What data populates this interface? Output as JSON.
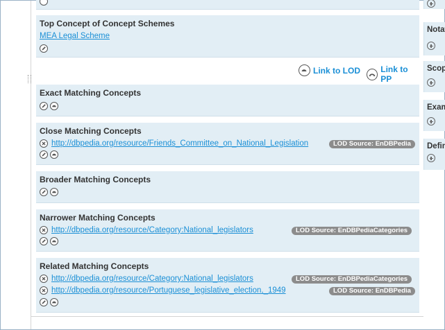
{
  "sections": {
    "top_concept": {
      "title": "Top Concept of Concept Schemes",
      "link": "MEA Legal Scheme"
    },
    "exact": {
      "title": "Exact Matching Concepts"
    },
    "close": {
      "title": "Close Matching Concepts",
      "items": [
        {
          "url": "http://dbpedia.org/resource/Friends_Committee_on_National_Legislation",
          "source": "LOD Source: EnDBPedia"
        }
      ]
    },
    "broader": {
      "title": "Broader Matching Concepts"
    },
    "narrower": {
      "title": "Narrower Matching Concepts",
      "items": [
        {
          "url": "http://dbpedia.org/resource/Category:National_legislators",
          "source": "LOD Source: EnDBPediaCategories"
        }
      ]
    },
    "related": {
      "title": "Related Matching Concepts",
      "items": [
        {
          "url": "http://dbpedia.org/resource/Category:National_legislators",
          "source": "LOD Source: EnDBPediaCategories"
        },
        {
          "url": "http://dbpedia.org/resource/Portuguese_legislative_election,_1949",
          "source": "LOD Source: EnDBPedia"
        }
      ]
    }
  },
  "lod_bar": {
    "link_to_lod": "Link to LOD",
    "link_to_pp": "Link to PP"
  },
  "side_panels": [
    {
      "title": "Notat"
    },
    {
      "title": "Scop"
    },
    {
      "title": "Exam"
    },
    {
      "title": "Defin"
    }
  ]
}
